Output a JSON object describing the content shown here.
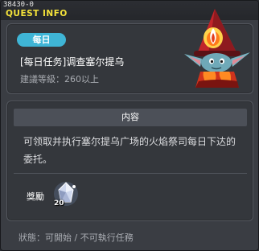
{
  "window": {
    "quest_id": "38430-0",
    "title": "QUEST INFO"
  },
  "quest": {
    "type_badge": "每日",
    "name": "[每日任务]调查塞尔提乌",
    "level_requirement": "建議等級：260以上",
    "npc_icon": "fire-jester-npc-icon"
  },
  "content": {
    "header": "内容",
    "description": "可领取并执行塞尔提乌广场的火焰祭司每日下达的委托。"
  },
  "reward": {
    "label": "獎勵",
    "item_icon": "shard-item-icon",
    "count": "20"
  },
  "status": {
    "text": "狀態：可開始 / 不可執行任務"
  },
  "colors": {
    "title": "#f4e23a",
    "badge": "#3fb5d6",
    "panel": "#34373c",
    "muted_text": "#a8abb1"
  }
}
